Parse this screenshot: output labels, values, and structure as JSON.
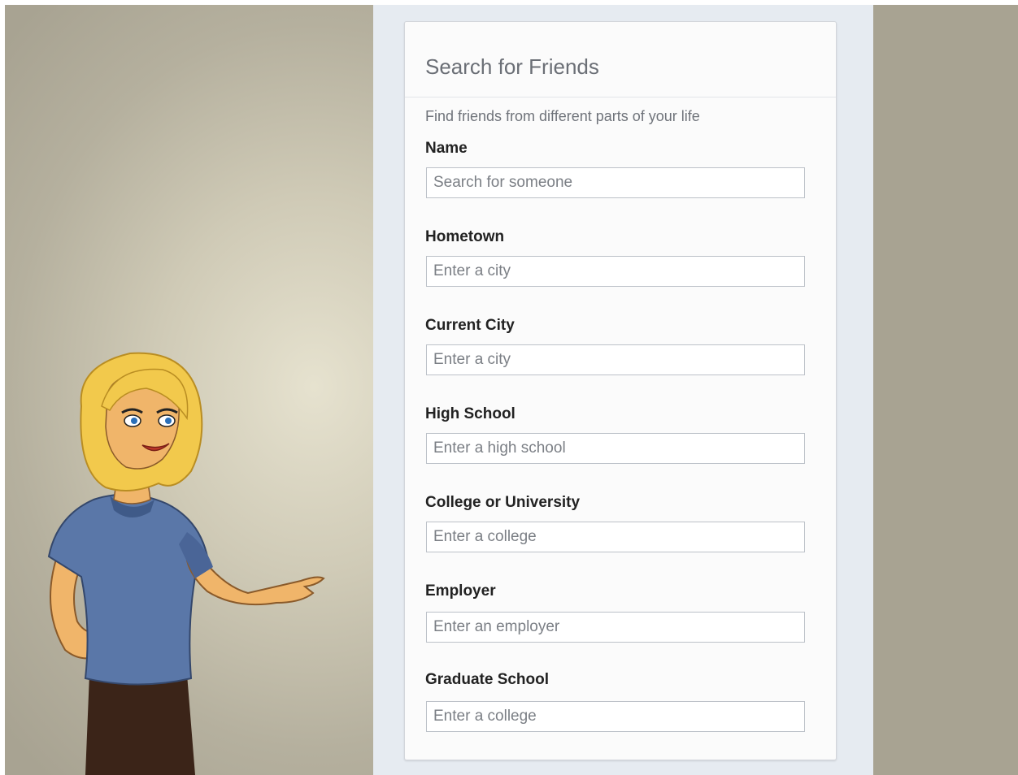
{
  "card": {
    "title": "Search for Friends",
    "intro": "Find friends from different parts of your life"
  },
  "fields": [
    {
      "label": "Name",
      "placeholder": "Search for someone",
      "value": ""
    },
    {
      "label": "Hometown",
      "placeholder": "Enter a city",
      "value": ""
    },
    {
      "label": "Current City",
      "placeholder": "Enter a city",
      "value": ""
    },
    {
      "label": "High School",
      "placeholder": "Enter a high school",
      "value": ""
    },
    {
      "label": "College or University",
      "placeholder": "Enter a college",
      "value": ""
    },
    {
      "label": "Employer",
      "placeholder": "Enter an employer",
      "value": ""
    },
    {
      "label": "Graduate School",
      "placeholder": "Enter a college",
      "value": ""
    }
  ],
  "illustration": {
    "icon": "cartoon-woman-pointing-icon"
  },
  "colors": {
    "panel": "#e6ebf1",
    "card": "#fbfbfb",
    "backdrop": "#c8c3b0",
    "shirt": "#5a77a8",
    "hair": "#f2c94c",
    "skin": "#f0b56a",
    "pants": "#3b2418"
  }
}
